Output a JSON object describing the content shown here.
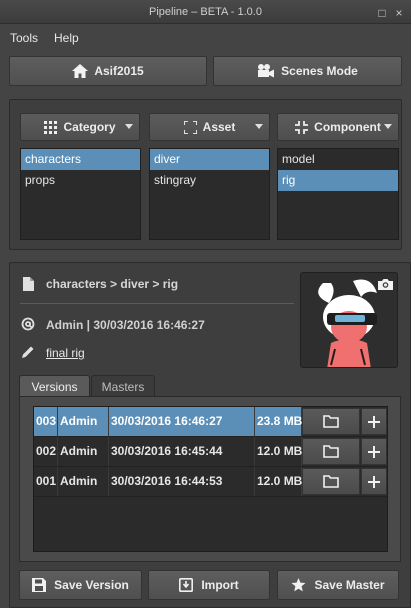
{
  "window": {
    "title": "Pipeline – BETA - 1.0.0",
    "close_glyph": "×",
    "max_glyph": "□"
  },
  "menu": [
    {
      "label": "Tools"
    },
    {
      "label": "Help"
    }
  ],
  "top_buttons": {
    "project": "Asif2015",
    "mode": "Scenes Mode"
  },
  "browser": {
    "category": {
      "label": "Category",
      "items": [
        {
          "label": "characters",
          "selected": true
        },
        {
          "label": "props",
          "selected": false
        }
      ]
    },
    "asset": {
      "label": "Asset",
      "items": [
        {
          "label": "diver",
          "selected": true
        },
        {
          "label": "stingray",
          "selected": false
        }
      ]
    },
    "component": {
      "label": "Component",
      "items": [
        {
          "label": "model",
          "selected": false
        },
        {
          "label": "rig",
          "selected": true
        }
      ]
    }
  },
  "details": {
    "path": "characters > diver > rig",
    "author_line": "Admin | 30/03/2016 16:46:27",
    "comment": "final rig"
  },
  "tabs": [
    {
      "label": "Versions",
      "active": true
    },
    {
      "label": "Masters",
      "active": false
    }
  ],
  "versions": [
    {
      "num": "003",
      "author": "Admin",
      "date": "30/03/2016 16:46:27",
      "size": "23.8 MB",
      "selected": true
    },
    {
      "num": "002",
      "author": "Admin",
      "date": "30/03/2016 16:45:44",
      "size": "12.0 MB",
      "selected": false
    },
    {
      "num": "001",
      "author": "Admin",
      "date": "30/03/2016 16:44:53",
      "size": "12.0 MB",
      "selected": false
    }
  ],
  "footer": {
    "save_version": "Save Version",
    "import": "Import",
    "save_master": "Save Master"
  },
  "colors": {
    "selection": "#5b8fb8",
    "background": "#444444"
  }
}
